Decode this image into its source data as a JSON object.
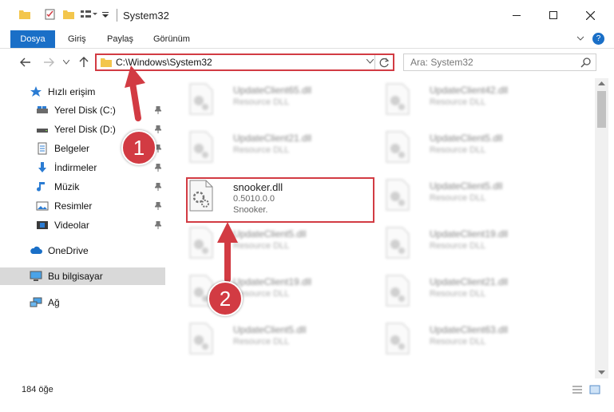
{
  "window": {
    "title": "System32",
    "controls": [
      "minimize",
      "maximize",
      "close"
    ]
  },
  "ribbon": {
    "tabs": [
      "Dosya",
      "Giriş",
      "Paylaş",
      "Görünüm"
    ]
  },
  "address": {
    "path": "C:\\Windows\\System32",
    "search_placeholder": "Ara: System32"
  },
  "sidebar": {
    "items": [
      {
        "label": "Hızlı erişim",
        "icon": "star-icon"
      },
      {
        "label": "Yerel Disk (C:)",
        "icon": "drive-icon",
        "pinned": true
      },
      {
        "label": "Yerel Disk (D:)",
        "icon": "drive-icon",
        "pinned": true
      },
      {
        "label": "Belgeler",
        "icon": "documents-icon",
        "pinned": true
      },
      {
        "label": "İndirmeler",
        "icon": "download-icon",
        "pinned": true
      },
      {
        "label": "Müzik",
        "icon": "music-icon",
        "pinned": true
      },
      {
        "label": "Resimler",
        "icon": "pictures-icon",
        "pinned": true
      },
      {
        "label": "Videolar",
        "icon": "videos-icon",
        "pinned": true
      },
      {
        "label": "OneDrive",
        "icon": "cloud-icon"
      },
      {
        "label": "Bu bilgisayar",
        "icon": "computer-icon",
        "selected": true
      },
      {
        "label": "Ağ",
        "icon": "network-icon"
      }
    ]
  },
  "files": {
    "left": [
      {
        "name": "UpdateClient65.dll",
        "type": "Resource DLL"
      },
      {
        "name": "UpdateClient21.dll",
        "type": "Resource DLL"
      },
      {
        "name": "snooker.dll",
        "version": "0.5010.0.0",
        "desc": "Snooker."
      },
      {
        "name": "UpdateClient5.dll",
        "type": "Resource DLL"
      },
      {
        "name": "UpdateClient19.dll",
        "type": "Resource DLL"
      },
      {
        "name": "UpdateClient5.dll",
        "type": "Resource DLL"
      }
    ],
    "right": [
      {
        "name": "UpdateClient42.dll",
        "type": "Resource DLL"
      },
      {
        "name": "UpdateClient5.dll",
        "type": "Resource DLL"
      },
      {
        "name": "UpdateClient5.dll",
        "type": "Resource DLL"
      },
      {
        "name": "UpdateClient19.dll",
        "type": "Resource DLL"
      },
      {
        "name": "UpdateClient21.dll",
        "type": "Resource DLL"
      },
      {
        "name": "UpdateClient63.dll",
        "type": "Resource DLL"
      }
    ]
  },
  "status": {
    "count": "184 öğe"
  },
  "callouts": {
    "one": "1",
    "two": "2",
    "color": "#d23b43"
  }
}
